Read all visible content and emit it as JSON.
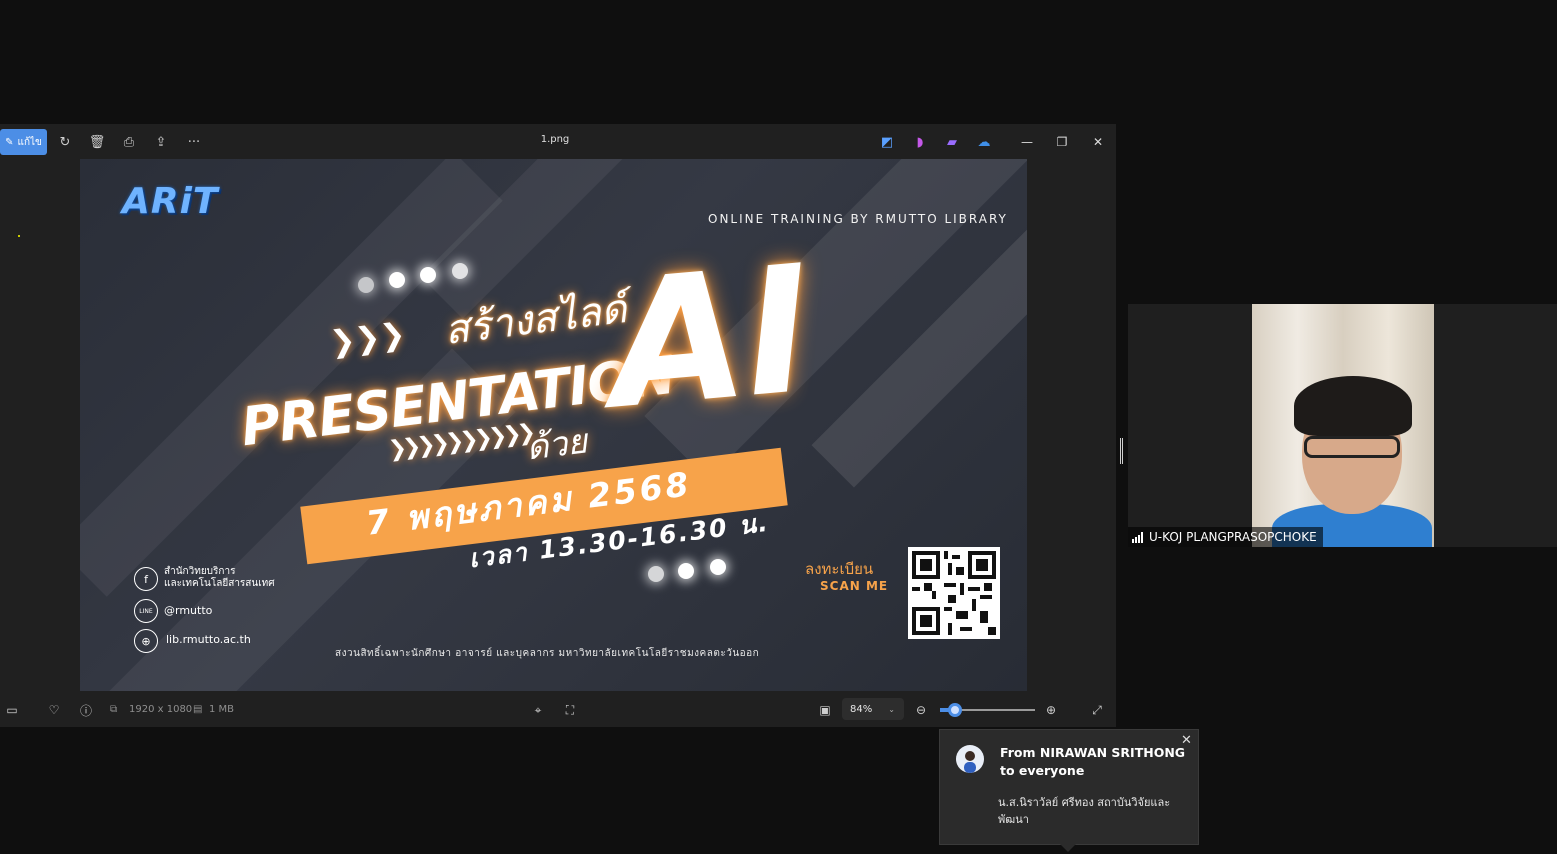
{
  "photos_app": {
    "edit_label": "แก้ไข",
    "file_name": "1.png",
    "toolbar_icons": [
      "edit-icon",
      "rotate-icon",
      "delete-icon",
      "print-icon",
      "share-icon",
      "more-icon"
    ],
    "window_controls": [
      "minimize",
      "restore",
      "close"
    ],
    "bottom": {
      "dimensions": "1920 x 1080",
      "file_size": "1 MB",
      "zoom": "84%",
      "zoom_fraction": 0.1
    }
  },
  "poster": {
    "logo": "ARiT",
    "online_training": "ONLINE TRAINING BY RMUTTO LIBRARY",
    "title_thai": "สร้างสไลด์",
    "title_presentation": "PRESENTATION",
    "title_ai": "AI",
    "title_with": "ด้วย",
    "date": "7 พฤษภาคม 2568",
    "time": "เวลา 13.30-16.30 น.",
    "register": "ลงทะเบียน",
    "scan_me": "SCAN ME",
    "facebook_line1": "สำนักวิทยบริการ",
    "facebook_line2": "และเทคโนโลยีสารสนเทศ",
    "line_icon_text": "LINE",
    "line_id": "@rmutto",
    "website": "lib.rmutto.ac.th",
    "footer": "สงวนสิทธิ์เฉพาะนักศึกษา อาจารย์ และบุคลากร มหาวิทยาลัยเทคโนโลยีราชมงคลตะวันออก"
  },
  "video": {
    "participant_name": "U-KOJ PLANGPRASOPCHOKE"
  },
  "chat_toast": {
    "from": "From NIRAWAN SRITHONG to everyone",
    "message": "น.ส.นิราวัลย์ ศรีทอง สถาบันวิจัยและพัฒนา"
  }
}
